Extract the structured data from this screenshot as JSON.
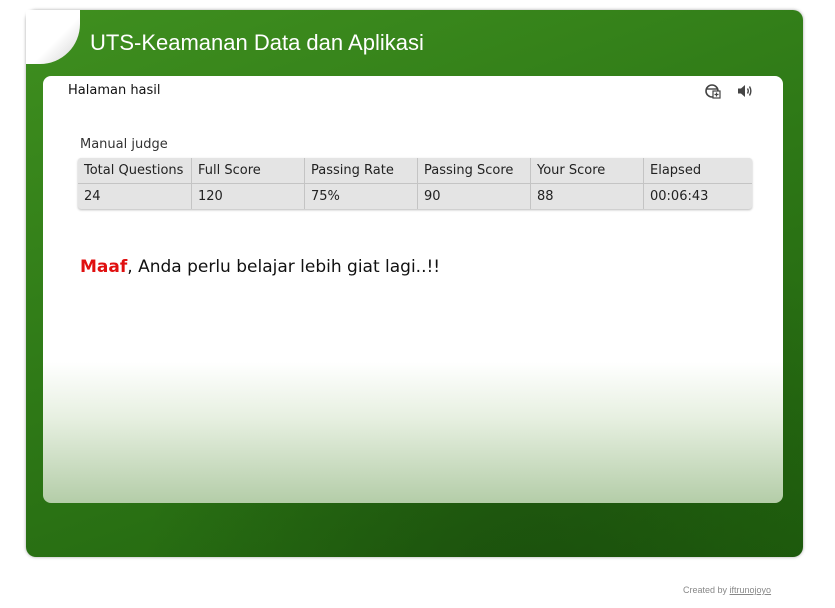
{
  "window": {
    "title": "UTS-Keamanan Data dan Aplikasi"
  },
  "page": {
    "heading": "Halaman hasil",
    "icons": [
      "navigation-icon",
      "sound-icon"
    ]
  },
  "result_table": {
    "caption": "Manual judge",
    "columns": [
      "Total Questions",
      "Full Score",
      "Passing Rate",
      "Passing Score",
      "Your Score",
      "Elapsed"
    ],
    "values": [
      "24",
      "120",
      "75%",
      "90",
      "88",
      "00:06:43"
    ]
  },
  "message": {
    "highlight": "Maaf",
    "text": ", Anda perlu belajar lebih giat lagi..!!",
    "highlight_color": "#e01010"
  },
  "footer": {
    "credit_prefix": "Created by ",
    "credit_link": "iftrunojoyo"
  },
  "theme": {
    "frame_green": "#2f7a17",
    "panel_bg": "#ffffff"
  }
}
